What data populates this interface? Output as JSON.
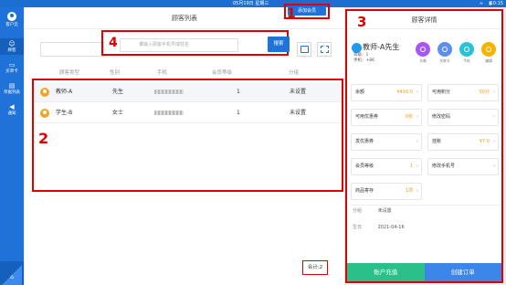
{
  "statusbar": {
    "datetime": "05月19日 星期三",
    "time": "10:15"
  },
  "sidebar": {
    "user_label": "客户云",
    "items": [
      {
        "label": "顾客"
      },
      {
        "label": "买单卡"
      },
      {
        "label": "单据列表"
      },
      {
        "label": "通知"
      }
    ]
  },
  "list_panel": {
    "title": "顾客列表",
    "add_button": "添加会员",
    "search_placeholder": "请输入顾客手机号或姓名",
    "search_button": "搜索",
    "columns": [
      "顾客类型",
      "性别",
      "手机",
      "会员等级",
      "分组"
    ],
    "rows": [
      {
        "name": "教师-A",
        "gender": "先生",
        "level": "1",
        "group": "未设置"
      },
      {
        "name": "学生-B",
        "gender": "女士",
        "level": "1",
        "group": "未设置"
      }
    ],
    "total": "合计:2"
  },
  "detail_panel": {
    "title": "顾客详情",
    "customer_name": "教师-A先生",
    "level_line": "等级：1",
    "phone_line": "手机：+86",
    "actions": [
      {
        "label": "头像",
        "color": "#a855f7"
      },
      {
        "label": "关联卡",
        "color": "#5b8ef0"
      },
      {
        "label": "手机",
        "color": "#27c4d8"
      },
      {
        "label": "编辑",
        "color": "#f5b400"
      }
    ],
    "cells": [
      {
        "label": "余额",
        "value": "¥410.0"
      },
      {
        "label": "可用积分",
        "value": "50分"
      },
      {
        "label": "可用优惠券",
        "value": "0张"
      },
      {
        "label": "修改密码",
        "value": ""
      },
      {
        "label": "发优惠券",
        "value": ""
      },
      {
        "label": "挂账",
        "value": "¥7.0"
      },
      {
        "label": "会员等级",
        "value": "1"
      },
      {
        "label": "修改手机号",
        "value": ""
      },
      {
        "label": "商品寄存",
        "value": "1项"
      }
    ],
    "group_label": "分组",
    "group_value": "未设置",
    "birthday_label": "生日",
    "birthday_value": "2021-04-16",
    "recharge_button": "账户充值",
    "create_order_button": "创建订单"
  },
  "annotations": [
    "1",
    "2",
    "3",
    "4"
  ],
  "colors": {
    "primary": "#1f73d8",
    "highlight": "#e00000",
    "accent": "#f39b1c"
  }
}
